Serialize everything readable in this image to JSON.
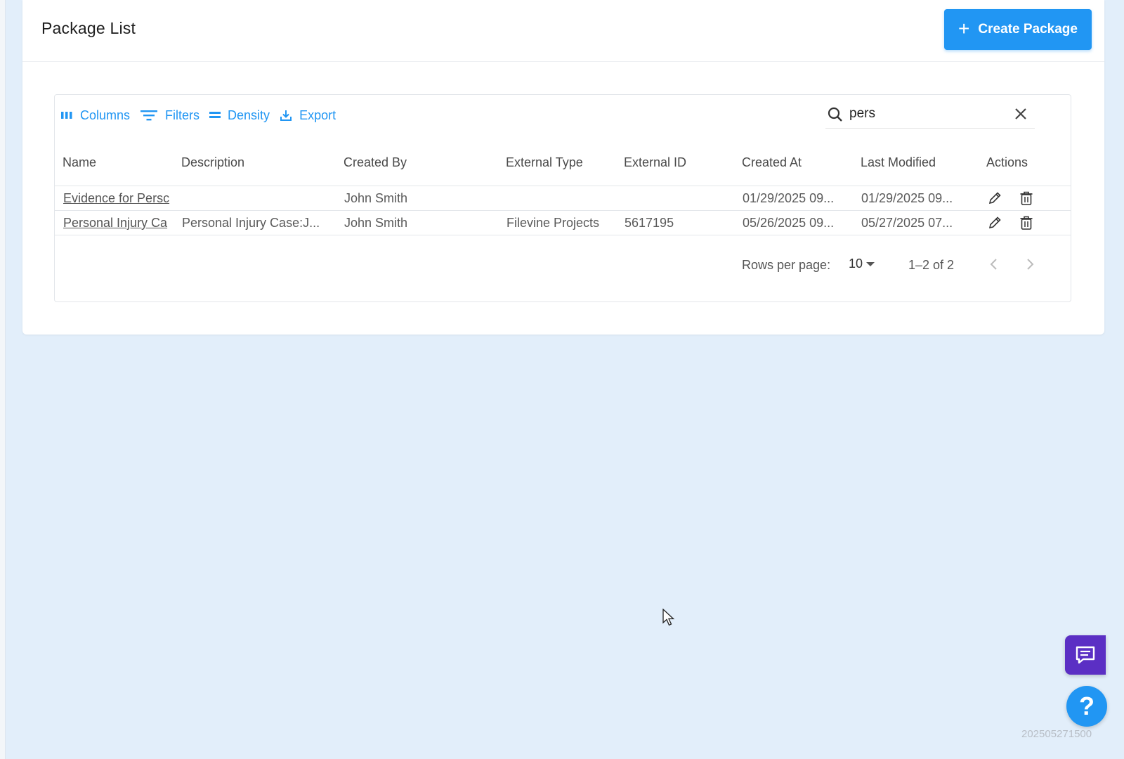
{
  "header": {
    "title": "Package List",
    "create_label": "Create Package"
  },
  "toolbar": {
    "columns": "Columns",
    "filters": "Filters",
    "density": "Density",
    "export": "Export"
  },
  "search": {
    "value": "pers"
  },
  "table": {
    "columns": [
      "Name",
      "Description",
      "Created By",
      "External Type",
      "External ID",
      "Created At",
      "Last Modified",
      "Actions"
    ],
    "rows": [
      {
        "name": "Evidence for Persc",
        "description": "",
        "created_by": "John Smith",
        "external_type": "",
        "external_id": "",
        "created_at": "01/29/2025 09...",
        "last_modified": "01/29/2025 09..."
      },
      {
        "name": "Personal Injury Ca",
        "description": "Personal Injury Case:J...",
        "created_by": "John Smith",
        "external_type": "Filevine Projects",
        "external_id": "5617195",
        "created_at": "05/26/2025 09...",
        "last_modified": "05/27/2025 07..."
      }
    ]
  },
  "pagination": {
    "rows_per_page_label": "Rows per page:",
    "rows_per_page_value": "10",
    "range": "1–2 of 2"
  },
  "stamp": "202505271500",
  "colors": {
    "primary": "#2196f3",
    "chat": "#5b2fc4",
    "background": "#e2eefa"
  }
}
